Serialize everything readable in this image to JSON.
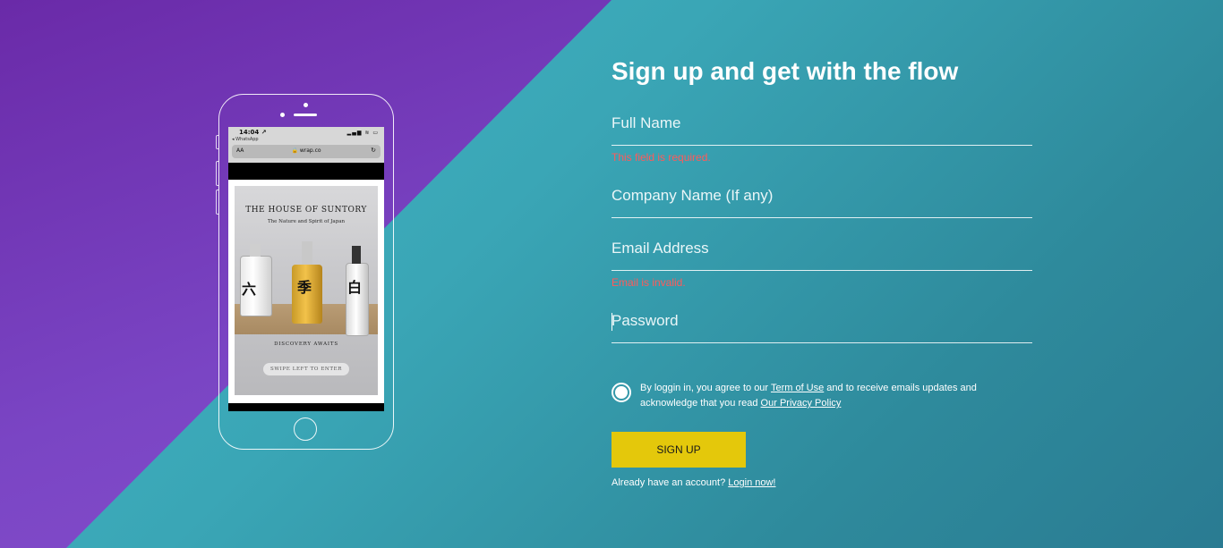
{
  "colors": {
    "purple_panel": "#7a45c4",
    "teal_background": "#3aa6b6",
    "error": "#ff5a5a",
    "button": "#e4c80b"
  },
  "phone": {
    "status_time": "14:04 ↗",
    "status_app": "◂ WhatsApp",
    "status_icons": "▂▄▆ ≋ ▭",
    "url_aa": "AA",
    "url": "🔒 wrap.co",
    "reload_icon": "↻",
    "ad": {
      "title": "THE HOUSE OF SUNTORY",
      "subtitle": "The Nature and Spirit of Japan",
      "kanji_left": "六",
      "kanji_mid": "季",
      "kanji_right": "白",
      "discover": "DISCOVERY AWAITS",
      "swipe": "SWIPE LEFT TO ENTER"
    }
  },
  "form": {
    "heading": "Sign up and get with the flow",
    "full_name_placeholder": "Full Name",
    "full_name_error": "This field is required.",
    "company_placeholder": "Company Name (If any)",
    "email_placeholder": "Email Address",
    "email_error": "Email is invalid.",
    "password_placeholder": "Password",
    "agree_prefix": "By loggin in, you agree to our ",
    "terms_link": "Term of Use",
    "agree_middle": " and to receive emails updates and acknowledge that you read ",
    "privacy_link": "Our Privacy Policy",
    "signup_button": "SIGN UP",
    "login_prompt": "Already have an account? ",
    "login_link": "Login now!"
  }
}
